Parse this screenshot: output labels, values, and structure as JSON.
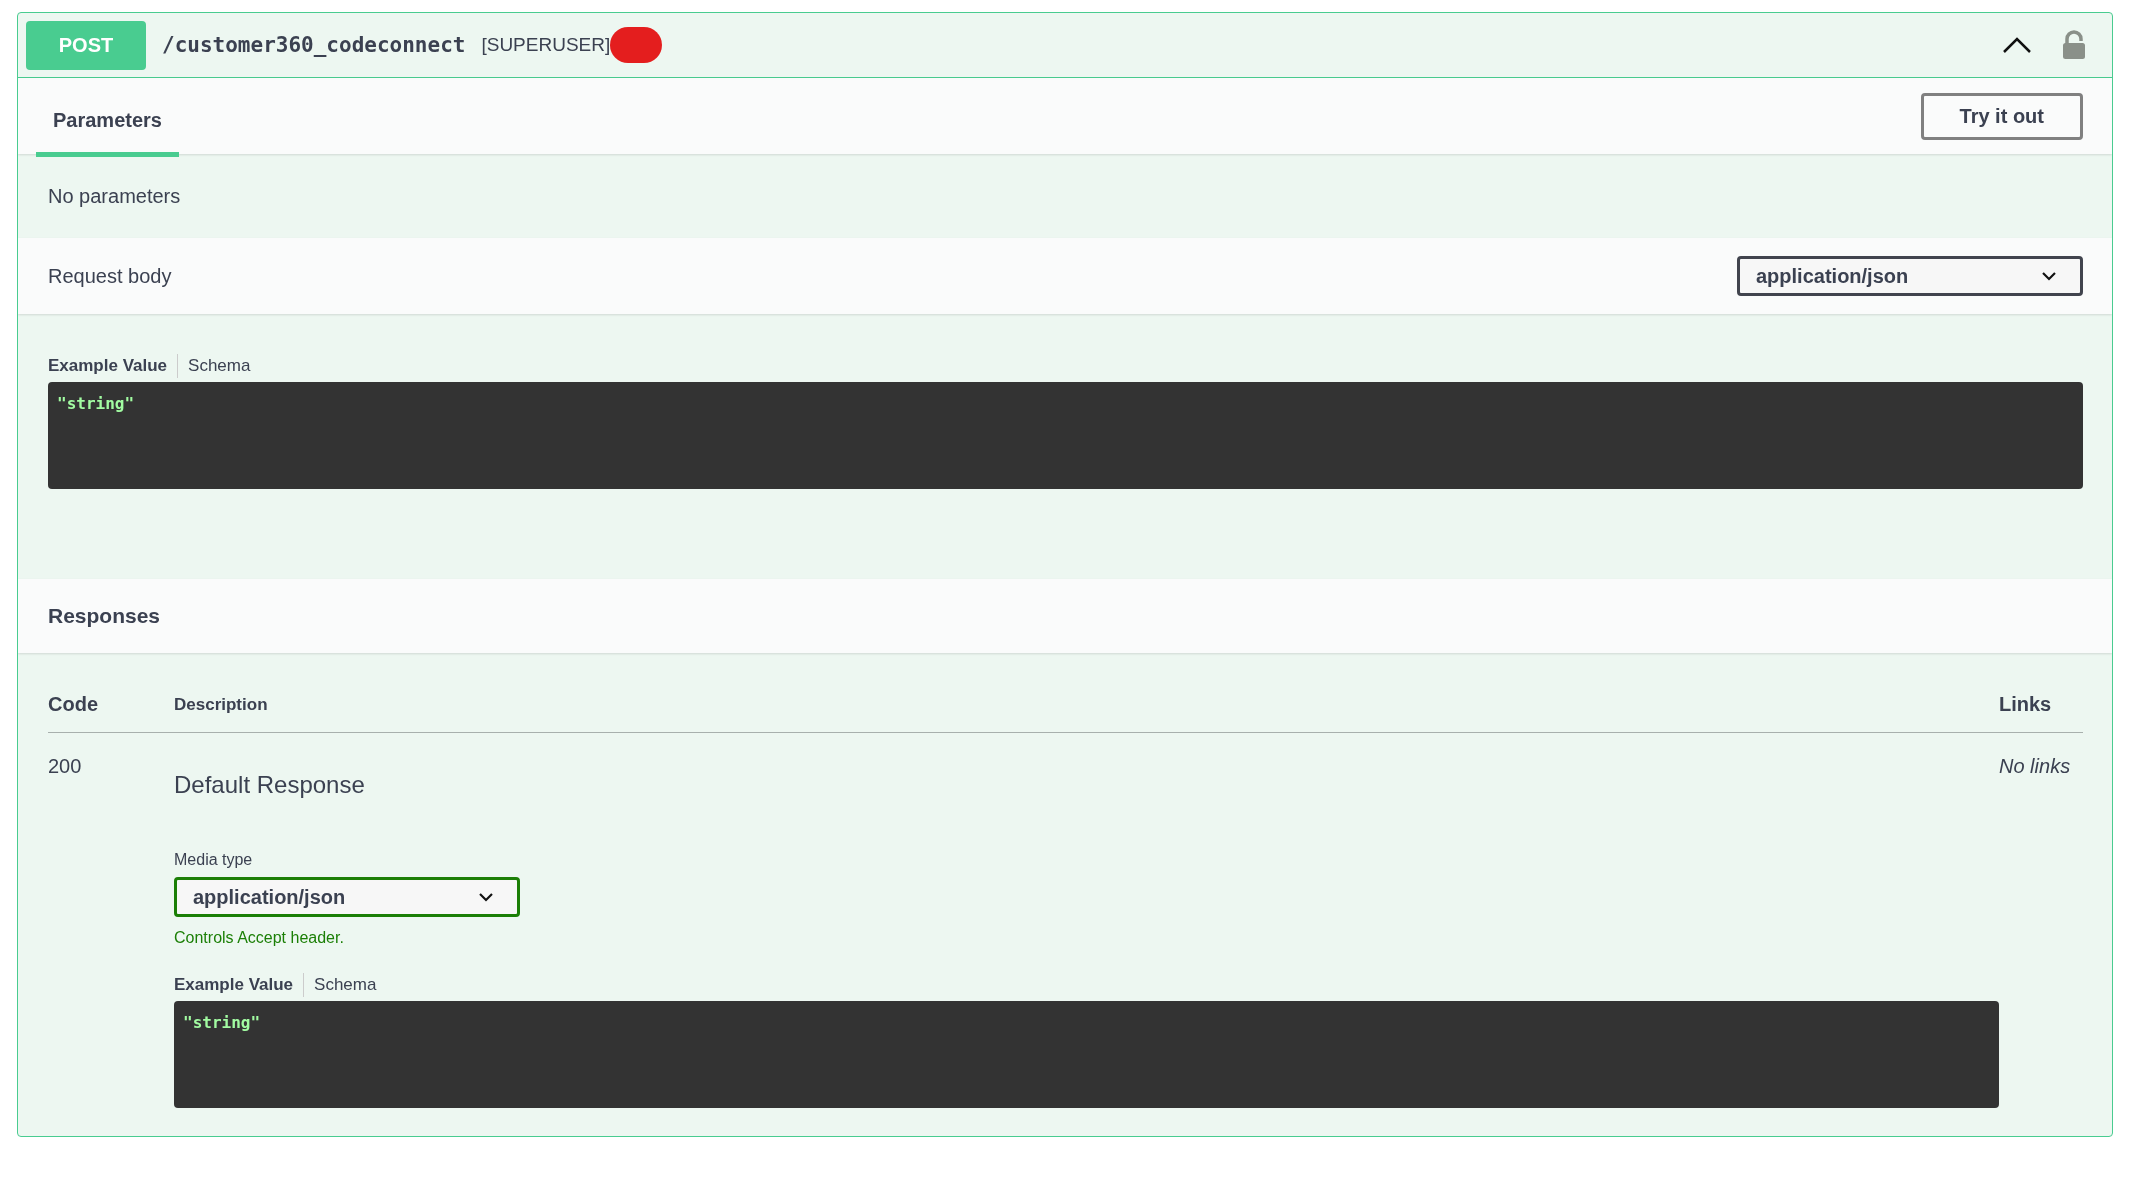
{
  "operation": {
    "method": "POST",
    "path": "/customer360_codeconnect",
    "tag": "[SUPERUSER]",
    "expanded": true,
    "locked": false
  },
  "section_tabs": [
    {
      "label": "Parameters",
      "selected": true
    }
  ],
  "try_button": "Try it out",
  "parameters_text": "No parameters",
  "request_body": {
    "label": "Request body",
    "content_type": "application/json",
    "example_tabs": [
      {
        "label": "Example Value",
        "selected": true
      },
      {
        "label": "Schema",
        "selected": false
      }
    ],
    "example": "\"string\""
  },
  "responses": {
    "title": "Responses",
    "columns": [
      "Code",
      "Description",
      "Links"
    ],
    "rows": [
      {
        "code": "200",
        "description": "Default Response",
        "media_type_label": "Media type",
        "media_type": "application/json",
        "media_hint": "Controls Accept header.",
        "example_tabs": [
          {
            "label": "Example Value",
            "selected": true
          },
          {
            "label": "Schema",
            "selected": false
          }
        ],
        "example": "\"string\"",
        "links": "No links"
      }
    ]
  }
}
